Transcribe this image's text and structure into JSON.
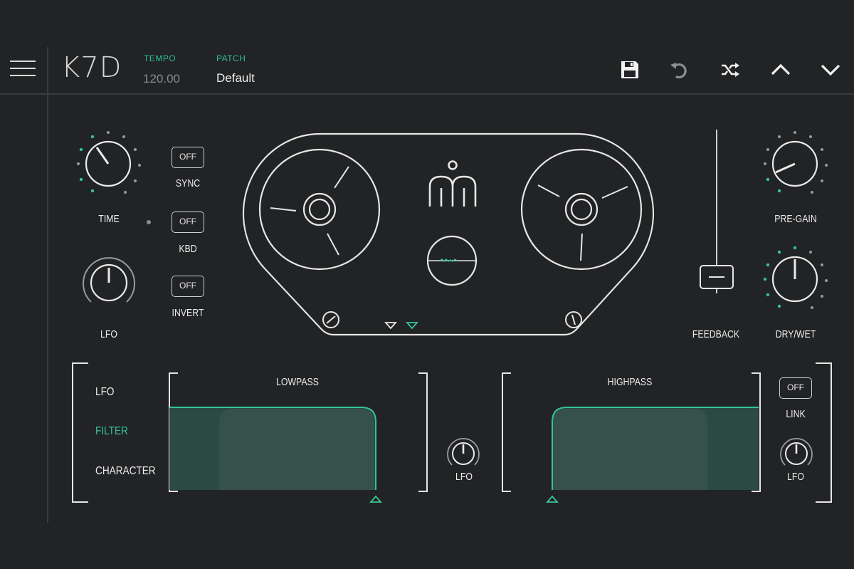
{
  "header": {
    "app_title": "K7D",
    "tempo_label": "TEMPO",
    "tempo_value": "120.00",
    "patch_label": "PATCH",
    "patch_value": "Default",
    "toolbar_icons": [
      "menu-icon",
      "save-icon",
      "undo-icon",
      "shuffle-icon",
      "chevron-up-icon",
      "chevron-down-icon"
    ]
  },
  "left_controls": {
    "time_label": "TIME",
    "lfo_label": "LFO",
    "sync_label": "SYNC",
    "sync_state": "OFF",
    "kbd_label": "KBD",
    "kbd_state": "OFF",
    "invert_label": "INVERT",
    "invert_state": "OFF"
  },
  "right_controls": {
    "feedback_label": "FEEDBACK",
    "pregain_label": "PRE-GAIN",
    "drywet_label": "DRY/WET"
  },
  "bottom": {
    "tabs": [
      "LFO",
      "FILTER",
      "CHARACTER"
    ],
    "active_tab": "FILTER",
    "lowpass_label": "LOWPASS",
    "highpass_label": "HIGHPASS",
    "lowpass_lfo_label": "LFO",
    "link_label": "LINK",
    "link_state": "OFF",
    "highpass_lfo_label": "LFO"
  },
  "colors": {
    "background": "#222325",
    "accent": "#35c494",
    "line": "#e6e6e6",
    "filter_fill": "#2b4a43",
    "filter_fill_inner": "#36514b"
  }
}
